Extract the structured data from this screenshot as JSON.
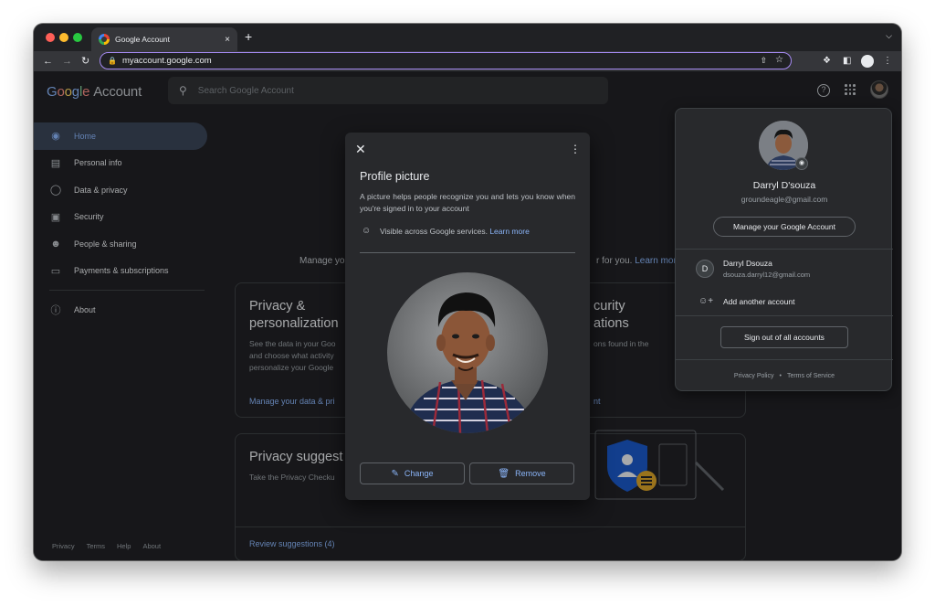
{
  "browser": {
    "tab_title": "Google Account",
    "tab_close": "×",
    "new_tab": "+",
    "url": "myaccount.google.com"
  },
  "header": {
    "logo_letters": [
      "G",
      "o",
      "o",
      "g",
      "l",
      "e"
    ],
    "logo_suffix": "Account",
    "search_placeholder": "Search Google Account",
    "help": "?"
  },
  "sidebar": {
    "items": [
      {
        "label": "Home",
        "icon": "home-icon",
        "active": true
      },
      {
        "label": "Personal info",
        "icon": "id-card-icon"
      },
      {
        "label": "Data & privacy",
        "icon": "toggle-icon"
      },
      {
        "label": "Security",
        "icon": "lock-icon"
      },
      {
        "label": "People & sharing",
        "icon": "people-icon"
      },
      {
        "label": "Payments & subscriptions",
        "icon": "credit-card-icon"
      }
    ],
    "about": "About",
    "footer": [
      "Privacy",
      "Terms",
      "Help",
      "About"
    ]
  },
  "main": {
    "manage_text": "Manage yo",
    "manage_right": "r for you.",
    "learn_more": "Learn mor",
    "privacy_card": {
      "title": "Privacy &\npersonalization",
      "text": "See the data in your Goo\nand choose what activity\npersonalize your Google",
      "link": "Manage your data & pri"
    },
    "security_card": {
      "title": "curity\nations",
      "text": "ons found in the",
      "link": "nt"
    },
    "suggestions_card": {
      "title": "Privacy suggest",
      "text": "Take the Privacy Checku",
      "link": "Review suggestions (4)"
    }
  },
  "account_popup": {
    "name": "Darryl D'souza",
    "email": "groundeagle@gmail.com",
    "manage_button": "Manage your Google Account",
    "other_account": {
      "initial": "D",
      "name": "Darryl Dsouza",
      "email": "dsouza.darryl12@gmail.com"
    },
    "add_account": "Add another account",
    "sign_out": "Sign out of all accounts",
    "privacy_policy": "Privacy Policy",
    "dot": "•",
    "terms": "Terms of Service"
  },
  "dialog": {
    "title": "Profile picture",
    "description": "A picture helps people recognize you and lets you know when you're signed in to your account",
    "visibility": "Visible across Google services.",
    "learn_more": "Learn more",
    "change_button": "Change",
    "remove_button": "Remove"
  },
  "colors": {
    "accent": "#8ab4f8",
    "page_bg": "#202124",
    "dialog_bg": "#28292c",
    "omnibox_border": "#a58af2"
  }
}
